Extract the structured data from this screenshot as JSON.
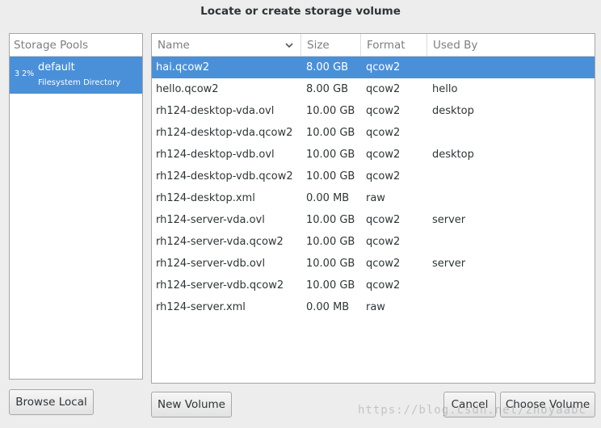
{
  "window": {
    "title": "Locate or create storage volume"
  },
  "pools": {
    "header": "Storage Pools",
    "items": [
      {
        "percent": "3 2%",
        "name": "default",
        "type": "Filesystem Directory"
      }
    ]
  },
  "volumes": {
    "headers": {
      "name": "Name",
      "size": "Size",
      "format": "Format",
      "used_by": "Used By"
    },
    "rows": [
      {
        "name": "hai.qcow2",
        "size": "8.00 GB",
        "format": "qcow2",
        "used_by": ""
      },
      {
        "name": "hello.qcow2",
        "size": "8.00 GB",
        "format": "qcow2",
        "used_by": "hello"
      },
      {
        "name": "rh124-desktop-vda.ovl",
        "size": "10.00 GB",
        "format": "qcow2",
        "used_by": "desktop"
      },
      {
        "name": "rh124-desktop-vda.qcow2",
        "size": "10.00 GB",
        "format": "qcow2",
        "used_by": ""
      },
      {
        "name": "rh124-desktop-vdb.ovl",
        "size": "10.00 GB",
        "format": "qcow2",
        "used_by": "desktop"
      },
      {
        "name": "rh124-desktop-vdb.qcow2",
        "size": "10.00 GB",
        "format": "qcow2",
        "used_by": ""
      },
      {
        "name": "rh124-desktop.xml",
        "size": "0.00 MB",
        "format": "raw",
        "used_by": ""
      },
      {
        "name": "rh124-server-vda.ovl",
        "size": "10.00 GB",
        "format": "qcow2",
        "used_by": "server"
      },
      {
        "name": "rh124-server-vda.qcow2",
        "size": "10.00 GB",
        "format": "qcow2",
        "used_by": ""
      },
      {
        "name": "rh124-server-vdb.ovl",
        "size": "10.00 GB",
        "format": "qcow2",
        "used_by": "server"
      },
      {
        "name": "rh124-server-vdb.qcow2",
        "size": "10.00 GB",
        "format": "qcow2",
        "used_by": ""
      },
      {
        "name": "rh124-server.xml",
        "size": "0.00 MB",
        "format": "raw",
        "used_by": ""
      }
    ]
  },
  "buttons": {
    "browse_local": "Browse Local",
    "new_volume": "New Volume",
    "cancel": "Cancel",
    "choose_volume": "Choose Volume"
  },
  "watermark": "https://blog.csdn.net/zhoyaabc",
  "icons": {
    "sort": "chevron-down-icon"
  },
  "colors": {
    "selection": "#4a90d9"
  }
}
